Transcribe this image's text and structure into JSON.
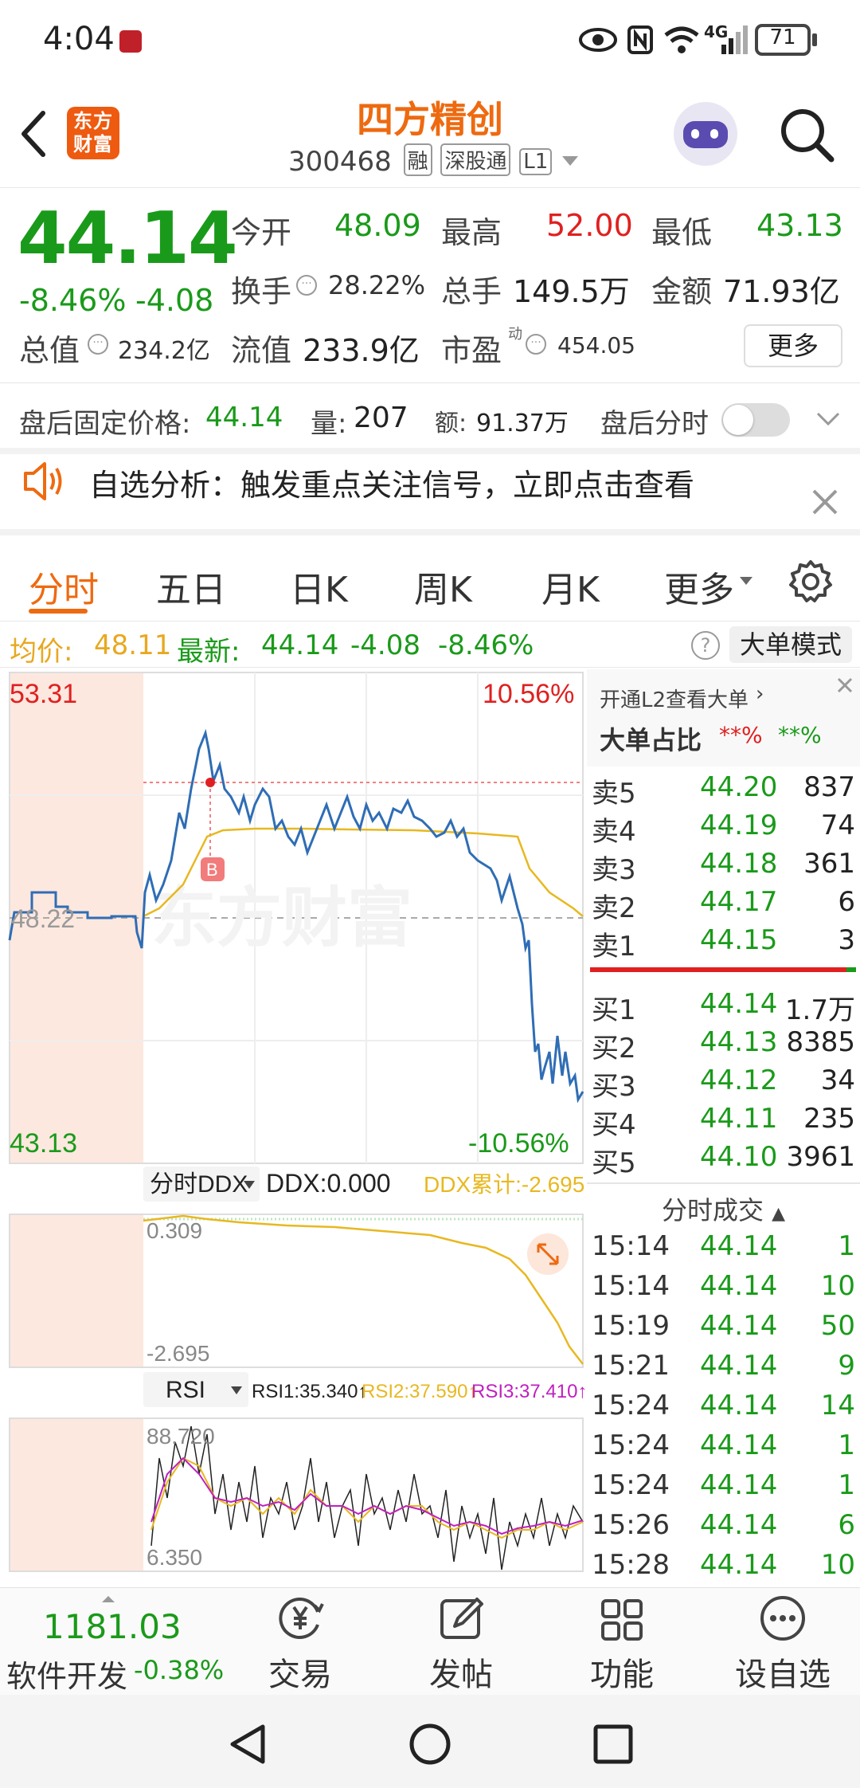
{
  "status": {
    "time": "4:04",
    "signal": "4G",
    "battery": "71"
  },
  "header": {
    "logo_text": "东方财富",
    "stock_name": "四方精创",
    "stock_code": "300468",
    "tags": [
      "融",
      "深股通",
      "L1"
    ]
  },
  "quote": {
    "price": "44.14",
    "change_pct": "-8.46%",
    "change_amt": "-4.08",
    "fields": [
      {
        "label": "今开",
        "value": "48.09",
        "color": "green"
      },
      {
        "label": "最高",
        "value": "52.00",
        "color": "red"
      },
      {
        "label": "最低",
        "value": "43.13",
        "color": "green"
      },
      {
        "label": "换手",
        "value": "28.22%",
        "color": "dark"
      },
      {
        "label": "总手",
        "value": "149.5万",
        "color": "dark"
      },
      {
        "label": "金额",
        "value": "71.93亿",
        "color": "dark"
      },
      {
        "label": "总值",
        "value": "234.2亿",
        "color": "dark"
      },
      {
        "label": "流值",
        "value": "233.9亿",
        "color": "dark"
      },
      {
        "label": "市盈",
        "value": "454.05",
        "color": "dark"
      }
    ],
    "pe_superscript": "动",
    "more_button": "更多"
  },
  "after_hours": {
    "price_label": "盘后固定价格:",
    "price": "44.14",
    "vol_label": "量:",
    "vol": "207",
    "amt_label": "额:",
    "amt": "91.37万",
    "toggle_label": "盘后分时"
  },
  "notice": {
    "text": "自选分析：触发重点关注信号，立即点击查看"
  },
  "tabs": [
    "分时",
    "五日",
    "日K",
    "周K",
    "月K",
    "更多"
  ],
  "active_tab": "分时",
  "summary": {
    "avg_label": "均价:",
    "avg": "48.11",
    "latest_label": "最新:",
    "latest": "44.14",
    "chg": "-4.08",
    "chg_pct": "-8.46%",
    "mode_button": "大单模式",
    "help": "?"
  },
  "chart": {
    "y_top": "53.31",
    "y_mid": "48.22",
    "y_bottom": "43.13",
    "pct_top": "10.56%",
    "pct_bottom": "-10.56%",
    "watermark": "东方财富",
    "marker": "B"
  },
  "ddx": {
    "selector": "分时DDX",
    "ddx_value": "DDX:0.000",
    "ddx_cum": "DDX累计:-2.695",
    "y_top": "0.309",
    "y_bottom": "-2.695"
  },
  "rsi": {
    "selector": "RSI",
    "rsi1": "RSI1:35.340↑",
    "rsi2": "RSI2:37.590↑",
    "rsi3": "RSI3:37.410↑",
    "y_top": "88.720",
    "y_bottom": "6.350"
  },
  "order_book": {
    "l2_link": "开通L2查看大单",
    "big_ratio_label": "大单占比",
    "big_ratio_red": "**%",
    "big_ratio_green": "**%",
    "asks": [
      {
        "label": "卖5",
        "price": "44.20",
        "vol": "837"
      },
      {
        "label": "卖4",
        "price": "44.19",
        "vol": "74"
      },
      {
        "label": "卖3",
        "price": "44.18",
        "vol": "361"
      },
      {
        "label": "卖2",
        "price": "44.17",
        "vol": "6"
      },
      {
        "label": "卖1",
        "price": "44.15",
        "vol": "3"
      }
    ],
    "bids": [
      {
        "label": "买1",
        "price": "44.14",
        "vol": "1.7万"
      },
      {
        "label": "买2",
        "price": "44.13",
        "vol": "8385"
      },
      {
        "label": "买3",
        "price": "44.12",
        "vol": "34"
      },
      {
        "label": "买4",
        "price": "44.11",
        "vol": "235"
      },
      {
        "label": "买5",
        "price": "44.10",
        "vol": "3961"
      }
    ],
    "trades_title": "分时成交",
    "trades": [
      {
        "time": "15:14",
        "price": "44.14",
        "vol": "1"
      },
      {
        "time": "15:14",
        "price": "44.14",
        "vol": "10"
      },
      {
        "time": "15:19",
        "price": "44.14",
        "vol": "50"
      },
      {
        "time": "15:21",
        "price": "44.14",
        "vol": "9"
      },
      {
        "time": "15:24",
        "price": "44.14",
        "vol": "14"
      },
      {
        "time": "15:24",
        "price": "44.14",
        "vol": "1"
      },
      {
        "time": "15:24",
        "price": "44.14",
        "vol": "1"
      },
      {
        "time": "15:26",
        "price": "44.14",
        "vol": "6"
      },
      {
        "time": "15:28",
        "price": "44.14",
        "vol": "10"
      }
    ]
  },
  "bottom": {
    "index_value": "1181.03",
    "index_name": "软件开发",
    "index_chg": "-0.38%",
    "items": [
      {
        "label": "交易",
        "icon": "yen-icon"
      },
      {
        "label": "发帖",
        "icon": "edit-icon"
      },
      {
        "label": "功能",
        "icon": "grid-icon"
      },
      {
        "label": "设自选",
        "icon": "more-icon"
      }
    ]
  },
  "chart_data": {
    "type": "line",
    "y_range": [
      43.13,
      53.31
    ],
    "reference_price": 48.22,
    "pct_range": [
      "-10.56%",
      "10.56%"
    ],
    "series": [
      {
        "values": [
          48.2,
          48.8,
          48.9,
          48.6,
          48.5,
          48.6,
          48.4,
          48.4,
          48.5,
          48.4,
          48.0,
          48.3,
          49.5,
          50.6,
          51.5,
          52.0,
          51.3,
          50.6,
          50.3,
          50.8,
          50.4,
          50.0,
          49.7,
          50.1,
          50.4,
          50.2,
          50.0,
          50.3,
          50.5,
          50.0,
          50.1,
          50.2,
          49.6,
          49.4,
          49.9,
          49.5,
          49.3,
          49.2,
          48.9,
          49.0,
          48.7,
          47.6,
          45.6,
          44.6,
          45.3,
          44.5,
          44.8,
          44.2,
          44.14
        ]
      },
      {
        "values": [
          48.2,
          48.25,
          48.4,
          48.7,
          49.0,
          49.3,
          49.5,
          49.7,
          49.75,
          49.78,
          49.8,
          49.8,
          49.78,
          49.75,
          49.72,
          49.7,
          49.65,
          49.55,
          49.3,
          48.9,
          48.4,
          48.11
        ]
      },
      {
        "values": [
          0.309,
          0.309,
          0.2,
          0.1,
          0.0,
          -0.05,
          -0.1,
          -0.15,
          -0.3,
          -0.6,
          -1.2,
          -2.0,
          -2.695
        ]
      },
      {
        "values": [
          88.72,
          50,
          62,
          38,
          45,
          30,
          55,
          40,
          52,
          35,
          48,
          28,
          42,
          36,
          50,
          30,
          38,
          6.35,
          40,
          35.34
        ]
      }
    ]
  },
  "colors": {
    "accent": "#ee6a10",
    "up": "#e02020",
    "down": "#1a9a1a",
    "price_line": "#2f6db5",
    "avg_line": "#e8b820",
    "shade": "#fde8df"
  }
}
